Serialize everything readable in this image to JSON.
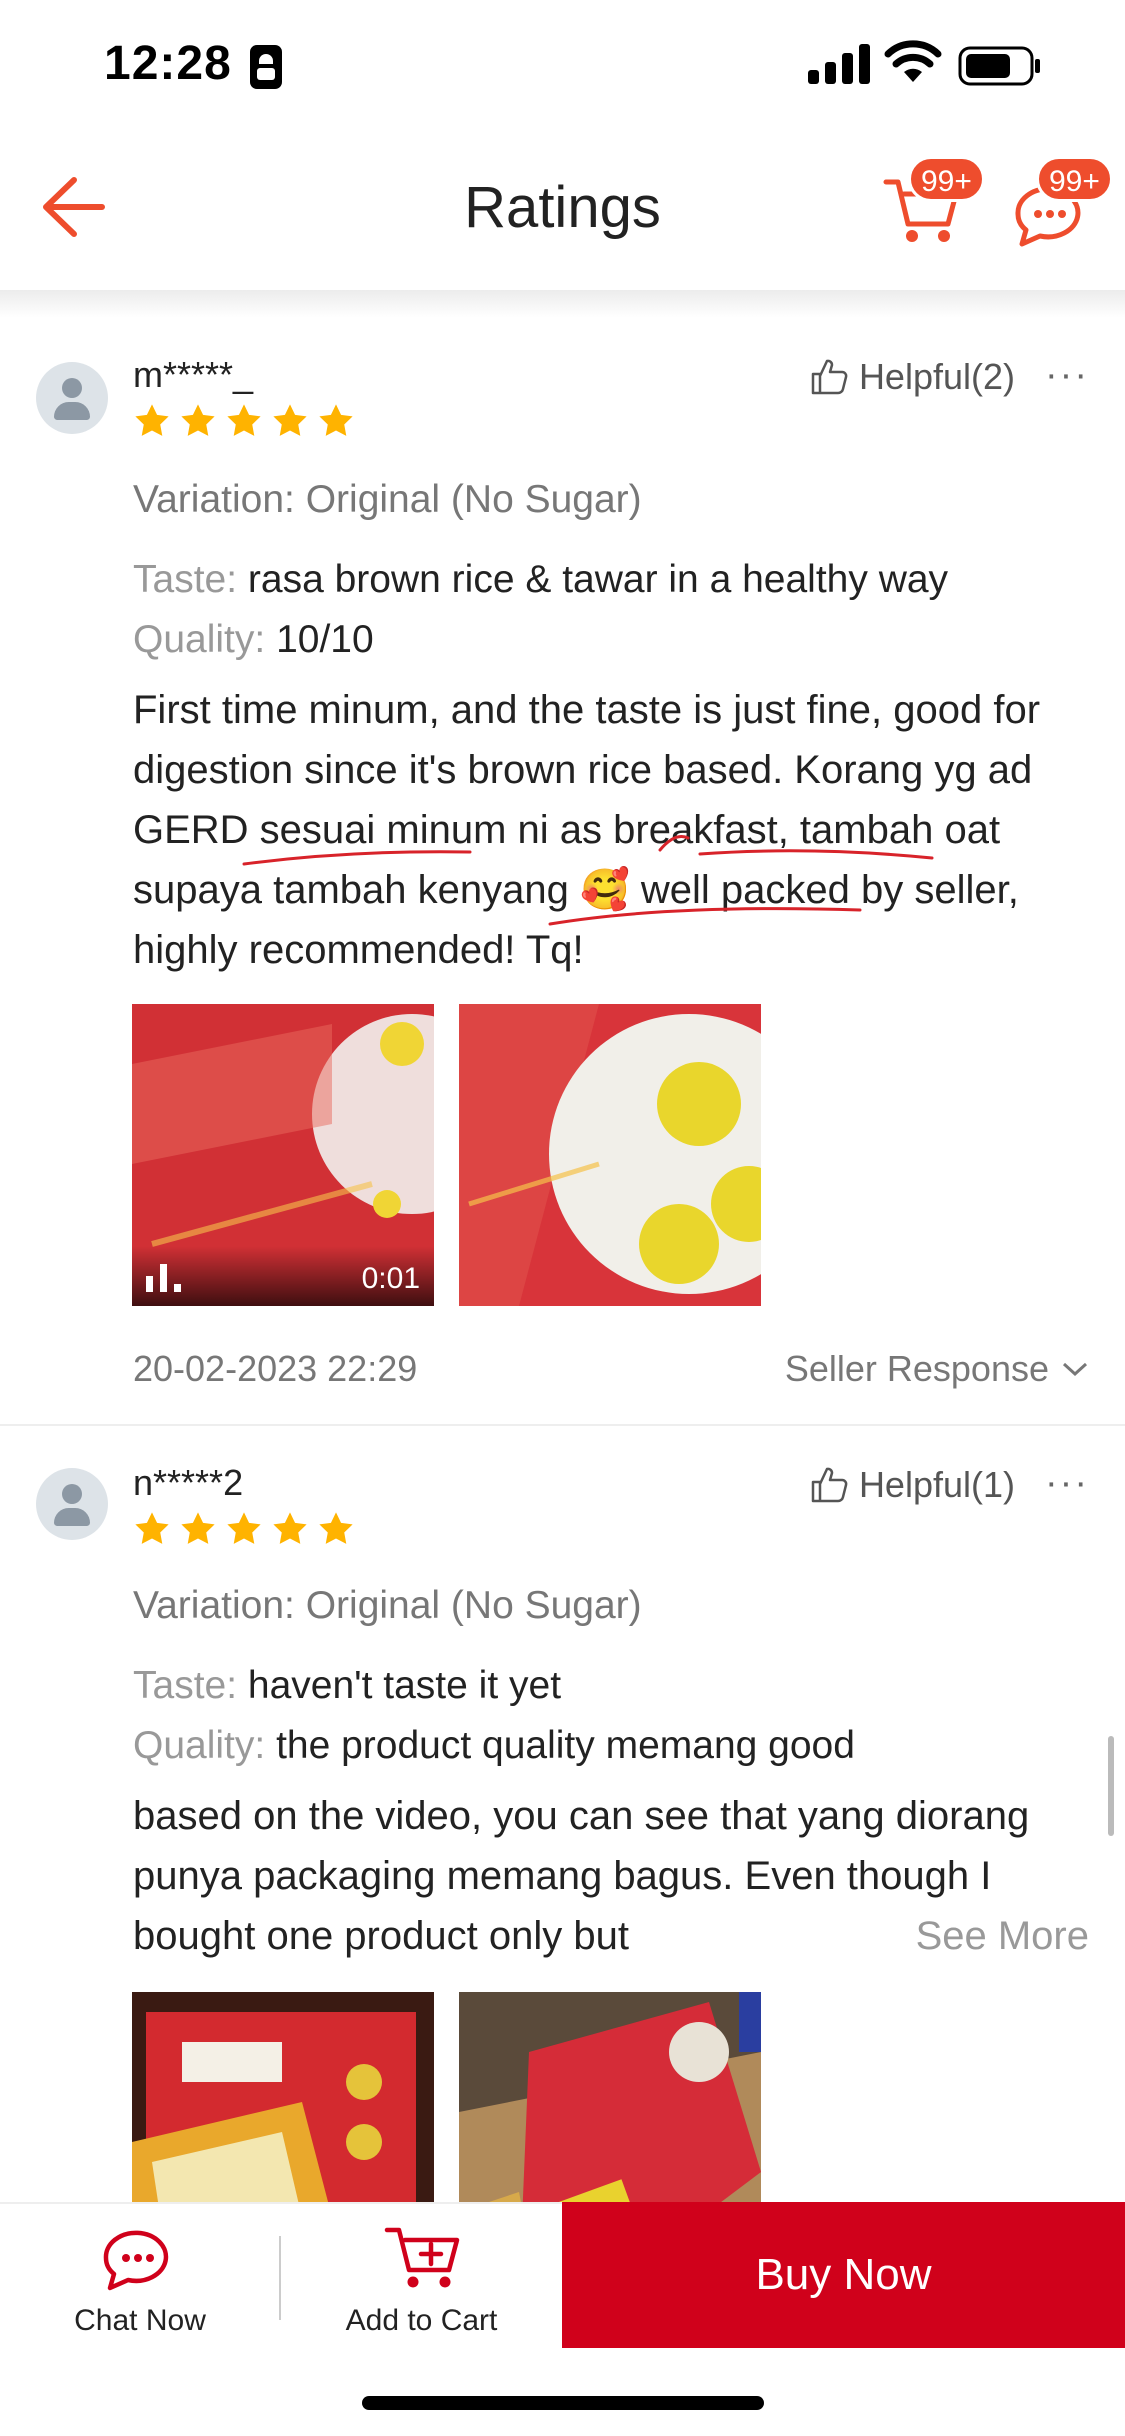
{
  "status_bar": {
    "time": "12:28"
  },
  "header": {
    "title": "Ratings",
    "cart_badge": "99+",
    "chat_badge": "99+"
  },
  "colors": {
    "accent": "#ee4d2d",
    "buy": "#d0011b",
    "star": "#ffb300"
  },
  "reviews": [
    {
      "username": "m*****_",
      "rating": 5,
      "helpful": "Helpful(2)",
      "variation": "Variation: Original (No Sugar)",
      "taste_key": "Taste:",
      "taste_value": "rasa brown rice & tawar in a healthy way",
      "quality_key": "Quality:",
      "quality_value": "10/10",
      "text": "First time minum, and the taste is just fine, good for digestion since it's brown rice based. Korang yg ad GERD sesuai minum ni as breakfast, tambah oat supaya tambah kenyang 🥰 well packed by seller, highly recommended! Tq!",
      "video_duration": "0:01",
      "date": "20-02-2023 22:29",
      "seller_response": "Seller Response"
    },
    {
      "username": "n*****2",
      "rating": 5,
      "helpful": "Helpful(1)",
      "variation": "Variation: Original (No Sugar)",
      "taste_key": "Taste:",
      "taste_value": "haven't taste it yet",
      "quality_key": "Quality:",
      "quality_value": "the product quality memang good",
      "text": "based on the video, you can see that yang diorang punya packaging memang bagus. Even though I bought one product only but",
      "see_more": "See More"
    }
  ],
  "bottom_bar": {
    "chat_now": "Chat Now",
    "add_to_cart": "Add to Cart",
    "buy_now": "Buy Now"
  }
}
